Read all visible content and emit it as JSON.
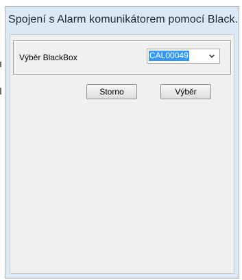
{
  "window": {
    "title": "Spojení s Alarm komunikátorem pomocí Black..."
  },
  "form": {
    "blackbox_label": "Výběr BlackBox",
    "blackbox_value": "CAL00049"
  },
  "buttons": {
    "cancel_label": "Storno",
    "select_label": "Výběr"
  },
  "icons": {
    "combo_arrow": "chevron-down-icon"
  },
  "colors": {
    "title_bar": "#dce8f3",
    "dialog_body": "#f0f0f0",
    "selection": "#3399ff"
  }
}
